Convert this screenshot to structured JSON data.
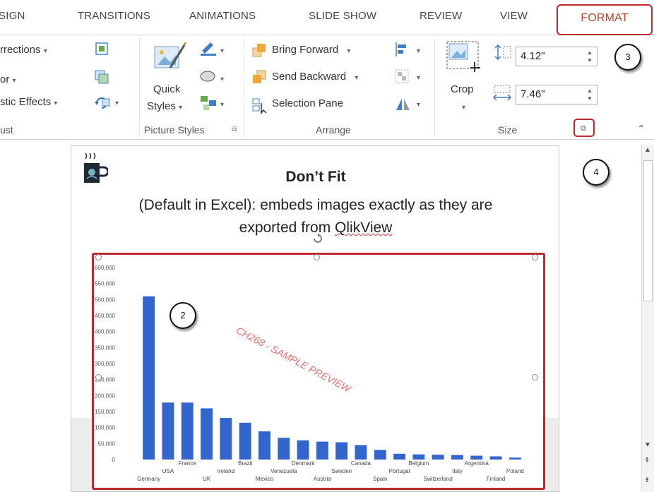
{
  "tabs": [
    "SIGN",
    "TRANSITIONS",
    "ANIMATIONS",
    "SLIDE SHOW",
    "REVIEW",
    "VIEW",
    "FORMAT"
  ],
  "adjust": {
    "corrections": "rrections",
    "color": "or",
    "artistic_effects": "stic Effects",
    "group_label": "ust"
  },
  "picture_styles": {
    "quick_styles_line1": "Quick",
    "quick_styles_line2": "Styles",
    "group_label": "Picture Styles"
  },
  "arrange": {
    "bring_forward": "Bring Forward",
    "send_backward": "Send Backward",
    "selection_pane": "Selection Pane",
    "group_label": "Arrange"
  },
  "size": {
    "crop": "Crop",
    "height": "4.12\"",
    "width": "7.46\"",
    "group_label": "Size"
  },
  "callouts": {
    "c2": "2",
    "c3": "3",
    "c4": "4"
  },
  "slide": {
    "title": "Don’t Fit",
    "subtitle_line1": "(Default in Excel): embeds images exactly as they are",
    "subtitle_line2_a": "exported fr",
    "subtitle_line2_b": "om ",
    "subtitle_line2_c": "QlikView",
    "watermark": "CH268 - SAMPLE PREVIEW"
  },
  "colors": {
    "accent": "#c0282d",
    "format_tab": "#b7472a",
    "bar": "#3366cc",
    "watermark": "#ee6b6b"
  },
  "chart_data": {
    "type": "bar",
    "categories": [
      "Germany",
      "USA",
      "France",
      "UK",
      "Ireland",
      "Brazil",
      "Mexico",
      "Venezuela",
      "Denmark",
      "Austria",
      "Sweden",
      "Canada",
      "Spain",
      "Portugal",
      "Belgium",
      "Switzerland",
      "Italy",
      "Argentina",
      "Finland",
      "Poland"
    ],
    "values": [
      510000,
      178000,
      178000,
      160000,
      130000,
      115000,
      88000,
      68000,
      60000,
      56000,
      54000,
      45000,
      30000,
      18000,
      16000,
      15000,
      14000,
      12000,
      10000,
      6000
    ],
    "yticks": [
      "600,000",
      "550,000",
      "500,000",
      "450,000",
      "400,000",
      "350,000",
      "300,000",
      "250,000",
      "200,000",
      "150,000",
      "100,000",
      "50,000",
      "0"
    ],
    "ylim": [
      0,
      600000
    ],
    "title": "",
    "xlabel": "",
    "ylabel": ""
  }
}
